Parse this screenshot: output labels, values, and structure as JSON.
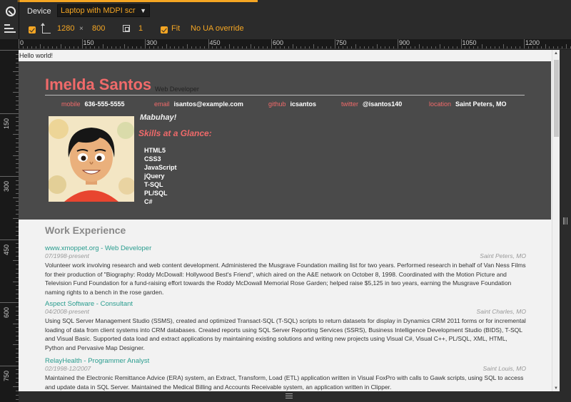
{
  "toolbar": {
    "device_label": "Device",
    "device_value": "Laptop with MDPI scr",
    "width": "1280",
    "times": "×",
    "height": "800",
    "dpr": "1",
    "fit_label": "Fit",
    "ua_label": "No UA override"
  },
  "ruler": {
    "top_labels": [
      "0",
      "150",
      "300",
      "450",
      "600",
      "750",
      "900",
      "1050",
      "1200"
    ],
    "left_labels": [
      "150",
      "300",
      "450",
      "600",
      "750"
    ]
  },
  "page": {
    "hello": "Hello world!",
    "name": "Imelda Santos",
    "role": "Web Developer",
    "contacts": [
      {
        "key": "mobile",
        "value": "636-555-5555"
      },
      {
        "key": "email",
        "value": "isantos@example.com"
      },
      {
        "key": "github",
        "value": "icsantos"
      },
      {
        "key": "twitter",
        "value": "@isantos140"
      },
      {
        "key": "location",
        "value": "Saint Peters, MO"
      }
    ],
    "greeting": "Mabuhay!",
    "skills_title": "Skills at a Glance:",
    "skills": [
      "HTML5",
      "CSS3",
      "JavaScript",
      "jQuery",
      "T-SQL",
      "PL/SQL",
      "C#"
    ],
    "work_title": "Work Experience",
    "jobs": [
      {
        "title": "www.xmoppet.org - Web Developer",
        "dates": "07/1998-present",
        "location": "Saint Peters, MO",
        "description": "Volunteer work involving research and web content development. Administered the Musgrave Foundation mailing list for two years. Performed research in behalf of Van Ness Films for their production of \"Biography: Roddy McDowall: Hollywood Best's Friend\", which aired on the A&E network on October 8, 1998. Coordinated with the Motion Picture and Television Fund Foundation for a fund-raising effort towards the Roddy McDowall Memorial Rose Garden; helped raise $5,125 in two years, earning the Musgrave Foundation naming rights to a bench in the rose garden."
      },
      {
        "title": "Aspect Software - Consultant",
        "dates": "04/2008-present",
        "location": "Saint Charles, MO",
        "description": "Using SQL Server Management Studio (SSMS), created and optimized Transact-SQL (T-SQL) scripts to return datasets for display in Dynamics CRM 2011 forms or for incremental loading of data from client systems into CRM databases. Created reports using SQL Server Reporting Services (SSRS), Business Intelligence Development Studio (BIDS), T-SQL and Visual Basic. Supported data load and extract applications by maintaining existing solutions and writing new projects using Visual C#, Visual C++, PL/SQL, XML, HTML, Python and Pervasive Map Designer."
      },
      {
        "title": "RelayHealth - Programmer Analyst",
        "dates": "02/1998-12/2007",
        "location": "Saint Louis, MO",
        "description": "Maintained the Electronic Remittance Advice (ERA) system, an Extract, Transform, Load (ETL) application written in Visual FoxPro with calls to Gawk scripts, using SQL to access and update data in SQL Server. Maintained the Medical Billing and Accounts Receivable system, an application written in Clipper."
      }
    ]
  }
}
